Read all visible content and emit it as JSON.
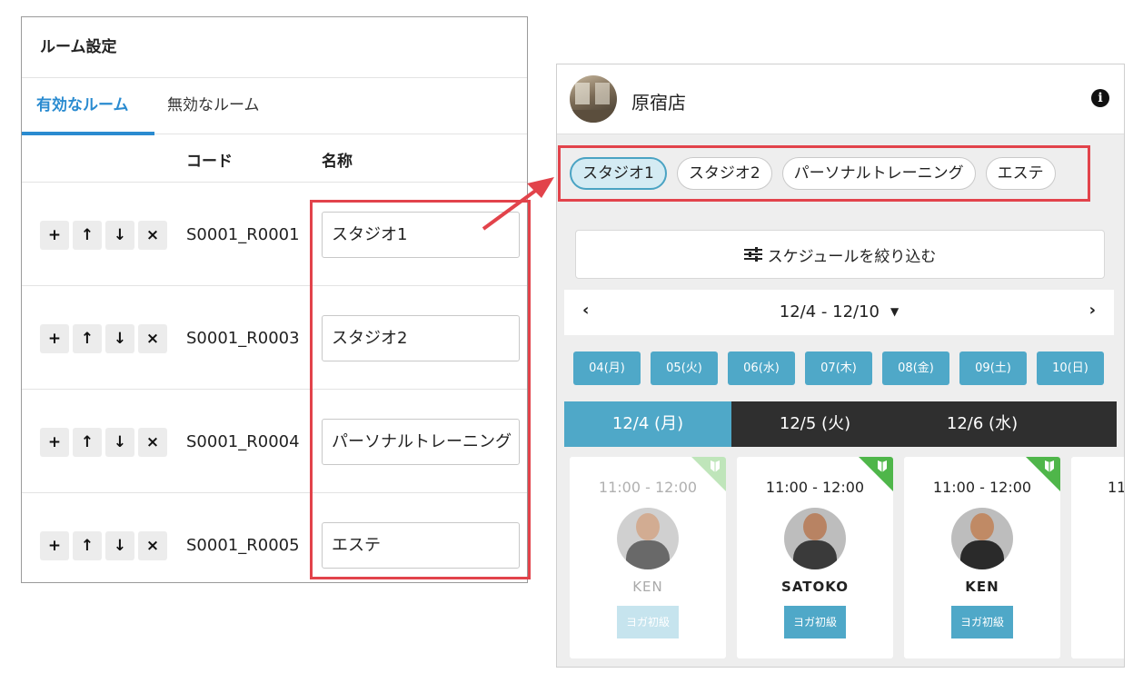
{
  "room_settings": {
    "title": "ルーム設定",
    "tabs": [
      "有効なルーム",
      "無効なルーム"
    ],
    "columns": {
      "code": "コード",
      "name": "名称"
    },
    "row_buttons": {
      "add": "+",
      "up": "↑",
      "down": "↓",
      "delete": "×"
    },
    "rows": [
      {
        "code": "S0001_R0001",
        "name": "スタジオ1"
      },
      {
        "code": "S0001_R0003",
        "name": "スタジオ2"
      },
      {
        "code": "S0001_R0004",
        "name": "パーソナルトレーニング"
      },
      {
        "code": "S0001_R0005",
        "name": "エステ"
      }
    ]
  },
  "mobile": {
    "store_name": "原宿店",
    "info_icon": "i",
    "room_chips": [
      "スタジオ1",
      "スタジオ2",
      "パーソナルトレーニング",
      "エステ"
    ],
    "active_chip": 0,
    "filter_label": "スケジュールを絞り込む",
    "date_nav": {
      "prev": "‹",
      "range": "12/4 - 12/10",
      "caret": "▼",
      "next": "›"
    },
    "days": [
      "04(月)",
      "05(火)",
      "06(水)",
      "07(木)",
      "08(金)",
      "09(土)",
      "10(日)"
    ],
    "week_tabs": [
      "12/4 (月)",
      "12/5 (火)",
      "12/6 (水)"
    ],
    "cards": [
      {
        "time": "11:00 - 12:00",
        "trainer": "KEN",
        "tag": "ヨガ初級"
      },
      {
        "time": "11:00 - 12:00",
        "trainer": "SATOKO",
        "tag": "ヨガ初級"
      },
      {
        "time": "11:00 - 12:00",
        "trainer": "KEN",
        "tag": "ヨガ初級"
      },
      {
        "time": "11"
      }
    ]
  },
  "colors": {
    "accent_blue": "#2a8bd0",
    "teal": "#4fa8c8",
    "highlight_red": "#e2434b",
    "beginner_green": "#4fb64a"
  }
}
